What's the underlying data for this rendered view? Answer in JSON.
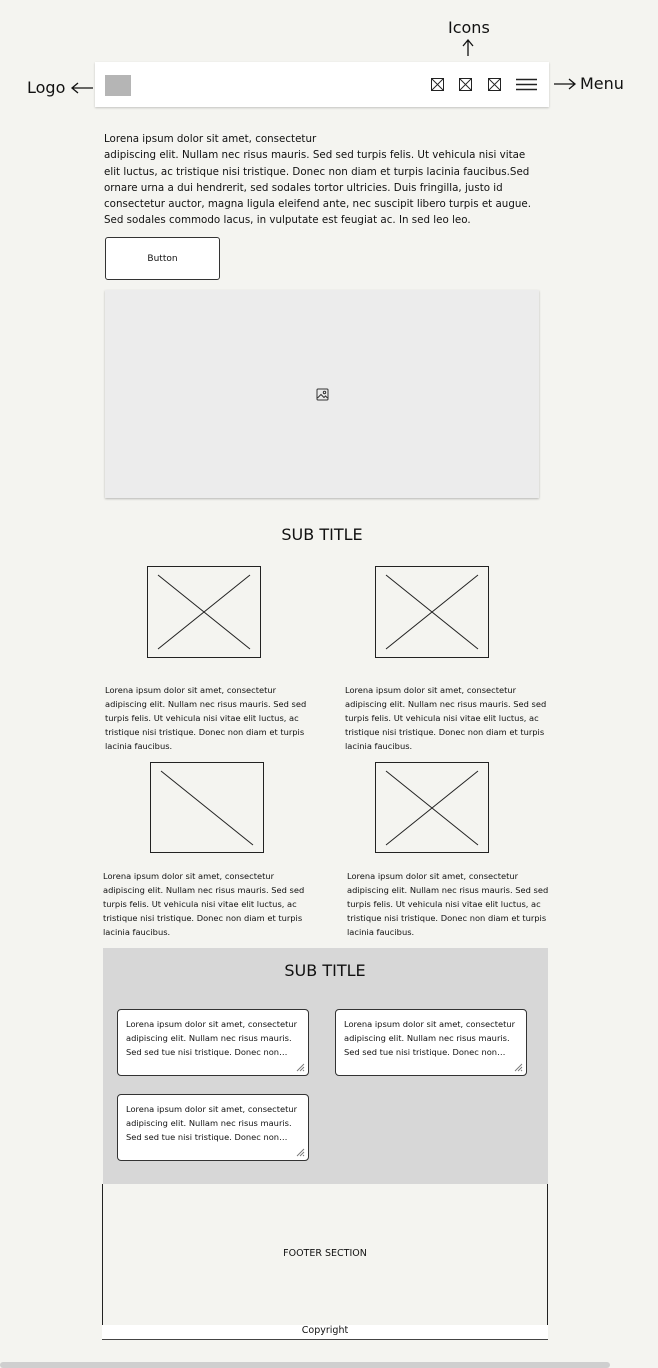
{
  "annotations": {
    "logo": "Logo",
    "icons": "Icons",
    "menu": "Menu"
  },
  "header": {
    "icons": [
      "image-icon",
      "image-icon",
      "image-icon"
    ],
    "menu_icon": "hamburger-icon"
  },
  "intro": {
    "text": "Lorena ipsum dolor sit amet, consectetur\nadipiscing elit. Nullam nec risus mauris. Sed sed turpis felis. Ut vehicula nisi vitae elit luctus, ac tristique nisi tristique. Donec non diam et turpis lacinia faucibus.Sed ornare urna a dui hendrerit, sed sodales tortor ultricies. Duis fringilla, justo id consectetur auctor, magna ligula eleifend ante, nec suscipit libero turpis et augue. Sed sodales commodo lacus, in vulputate est feugiat ac. In sed leo leo."
  },
  "button": {
    "label": "Button"
  },
  "hero": {
    "icon": "image-icon"
  },
  "section1": {
    "title": "SUB TITLE",
    "items": [
      {
        "text": "Lorena ipsum dolor sit amet, consectetur adipiscing elit. Nullam nec risus mauris. Sed sed turpis felis. Ut vehicula nisi vitae elit luctus, ac tristique nisi tristique. Donec non diam et turpis lacinia faucibus."
      },
      {
        "text": "Lorena ipsum dolor sit amet, consectetur adipiscing elit. Nullam nec risus mauris. Sed sed turpis felis. Ut vehicula nisi vitae elit luctus, ac tristique nisi tristique. Donec non diam et turpis lacinia faucibus."
      },
      {
        "text": "Lorena ipsum dolor sit amet, consectetur adipiscing elit. Nullam nec risus mauris. Sed sed turpis felis. Ut vehicula nisi vitae elit luctus, ac tristique nisi tristique. Donec non diam et turpis lacinia faucibus."
      },
      {
        "text": "Lorena ipsum dolor sit amet, consectetur adipiscing elit. Nullam nec risus mauris. Sed sed turpis felis. Ut vehicula nisi vitae elit luctus, ac tristique nisi tristique. Donec non diam et turpis lacinia faucibus."
      }
    ]
  },
  "section2": {
    "title": "SUB TITLE",
    "cards": [
      {
        "text": "Lorena ipsum dolor sit amet, consectetur adipiscing elit. Nullam nec risus mauris. Sed sed tue nisi tristique. Donec non diam et turpis"
      },
      {
        "text": "Lorena ipsum dolor sit amet, consectetur adipiscing elit. Nullam nec risus mauris. Sed sed tue nisi tristique. Donec non diam et turpis"
      },
      {
        "text": "Lorena ipsum dolor sit amet, consectetur adipiscing elit. Nullam nec risus mauris. Sed sed tue nisi tristique. Donec non diam et turpis"
      }
    ]
  },
  "footer": {
    "label": "FOOTER SECTION",
    "copyright": "Copyright"
  }
}
